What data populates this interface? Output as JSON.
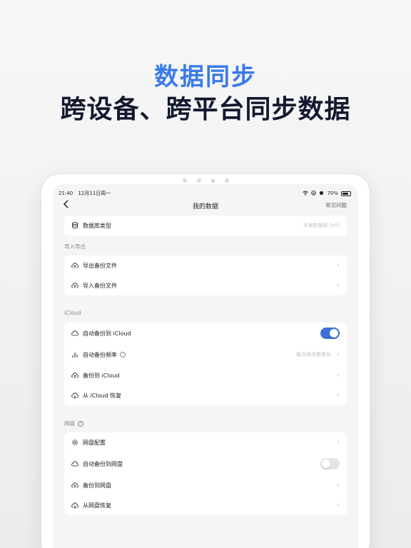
{
  "headline": {
    "title": "数据同步",
    "subtitle": "跨设备、跨平台同步数据"
  },
  "status_bar": {
    "time": "21:40",
    "date": "12月11日周一",
    "battery": "70%"
  },
  "nav": {
    "back_icon": "chevron-left-icon",
    "title": "我的数据",
    "faq": "常见问题"
  },
  "database": {
    "label": "数据库类型",
    "value": "本地数据库 (v5)",
    "icon": "database-icon"
  },
  "import_export": {
    "section": "导入导出",
    "items": [
      {
        "label": "导出备份文件",
        "icon": "cloud-upload-icon"
      },
      {
        "label": "导入备份文件",
        "icon": "cloud-upload-icon"
      }
    ]
  },
  "icloud": {
    "section": "iCloud",
    "auto_backup": {
      "label": "自动备份到 iCloud",
      "enabled": true
    },
    "frequency": {
      "label": "自动备份频率",
      "value": "每次修改都备份"
    },
    "backup": {
      "label": "备份到 iCloud"
    },
    "restore": {
      "label": "从 iCloud 恢复"
    }
  },
  "netdisk": {
    "section": "网盘",
    "config": {
      "label": "网盘配置"
    },
    "auto_backup": {
      "label": "自动备份到网盘",
      "enabled": false
    },
    "backup": {
      "label": "备份到网盘"
    },
    "restore": {
      "label": "从网盘恢复"
    }
  },
  "colors": {
    "accent": "#3a7be8",
    "toggle_on": "#3d6fd6",
    "headline_dark": "#14182e"
  }
}
